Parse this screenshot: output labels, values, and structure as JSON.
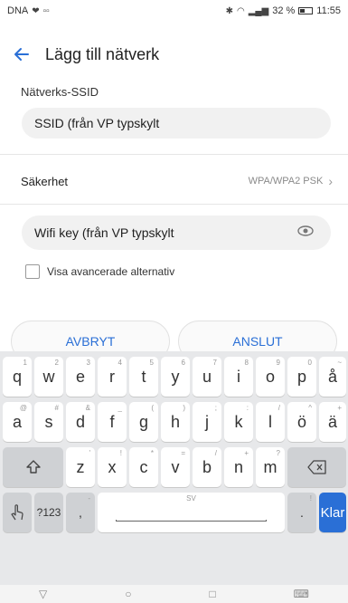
{
  "status_bar": {
    "carrier": "DNA",
    "signal": "▫▫",
    "battery_percent": "32 %",
    "time": "11:55"
  },
  "app_bar": {
    "title": "Lägg till nätverk"
  },
  "ssid": {
    "label": "Nätverks-SSID",
    "value": "SSID (från VP typskylt"
  },
  "security": {
    "label": "Säkerhet",
    "value": "WPA/WPA2 PSK"
  },
  "password": {
    "value": "Wifi key (från VP typskylt"
  },
  "advanced": {
    "label": "Visa avancerade alternativ"
  },
  "buttons": {
    "cancel": "AVBRYT",
    "connect": "ANSLUT"
  },
  "keyboard": {
    "row1": [
      {
        "key": "q",
        "hint": "1"
      },
      {
        "key": "w",
        "hint": "2"
      },
      {
        "key": "e",
        "hint": "3"
      },
      {
        "key": "r",
        "hint": "4"
      },
      {
        "key": "t",
        "hint": "5"
      },
      {
        "key": "y",
        "hint": "6"
      },
      {
        "key": "u",
        "hint": "7"
      },
      {
        "key": "i",
        "hint": "8"
      },
      {
        "key": "o",
        "hint": "9"
      },
      {
        "key": "p",
        "hint": "0"
      },
      {
        "key": "å",
        "hint": "~"
      }
    ],
    "row2": [
      {
        "key": "a",
        "hint": "@"
      },
      {
        "key": "s",
        "hint": "#"
      },
      {
        "key": "d",
        "hint": "&"
      },
      {
        "key": "f",
        "hint": "_"
      },
      {
        "key": "g",
        "hint": "("
      },
      {
        "key": "h",
        "hint": ")"
      },
      {
        "key": "j",
        "hint": ";"
      },
      {
        "key": "k",
        "hint": ":"
      },
      {
        "key": "l",
        "hint": "/"
      },
      {
        "key": "ö",
        "hint": "^"
      },
      {
        "key": "ä",
        "hint": "+"
      }
    ],
    "row3": [
      {
        "key": "z",
        "hint": "'"
      },
      {
        "key": "x",
        "hint": "!"
      },
      {
        "key": "c",
        "hint": "*"
      },
      {
        "key": "v",
        "hint": "="
      },
      {
        "key": "b",
        "hint": "/"
      },
      {
        "key": "n",
        "hint": "+"
      },
      {
        "key": "m",
        "hint": "?"
      }
    ],
    "shift_icon": "shift-icon",
    "backspace_icon": "backspace-icon",
    "gesture_icon": "hand-icon",
    "numbers_label": "?123",
    "comma": ",",
    "comma_hint": "-",
    "space_hint": "SV",
    "period": ".",
    "period_hint": "!",
    "enter_label": "Klar"
  },
  "nav": {
    "back": "▽",
    "home": "○",
    "recent": "□",
    "keyboard": "⌨"
  }
}
